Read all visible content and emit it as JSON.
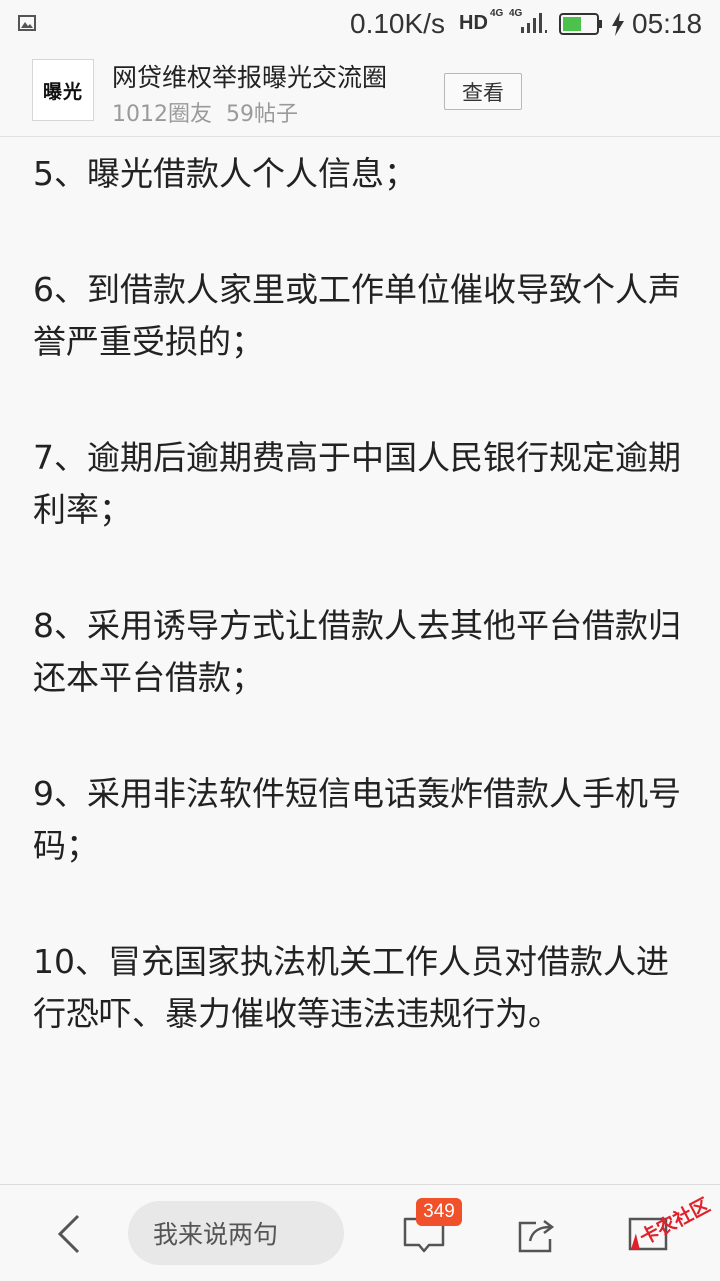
{
  "status_bar": {
    "speed": "0.10K/s",
    "hd": "HD",
    "net1": "4G",
    "net2": "4G",
    "time": "05:18",
    "battery_level": 0.55
  },
  "circle": {
    "logo_text": "曝光",
    "title": "网贷维权举报曝光交流圈",
    "members": "1012圈友",
    "posts": "59帖子",
    "view_label": "查看"
  },
  "paragraphs": [
    "5、曝光借款人个人信息；",
    "6、到借款人家里或工作单位催收导致个人声誉严重受损的；",
    "7、逾期后逾期费高于中国人民银行规定逾期利率；",
    "8、采用诱导方式让借款人去其他平台借款归还本平台借款；",
    "9、采用非法软件短信电话轰炸借款人手机号码；",
    "10、冒充国家执法机关工作人员对借款人进行恐吓、暴力催收等违法违规行为。"
  ],
  "bottom_bar": {
    "input_placeholder": "我来说两句",
    "comment_count": "349"
  },
  "watermark": {
    "text": "卡农社区"
  },
  "colors": {
    "background": "#f8f8f8",
    "badge": "#f0502a",
    "battery": "#4cc24c",
    "watermark": "#e0202a"
  }
}
